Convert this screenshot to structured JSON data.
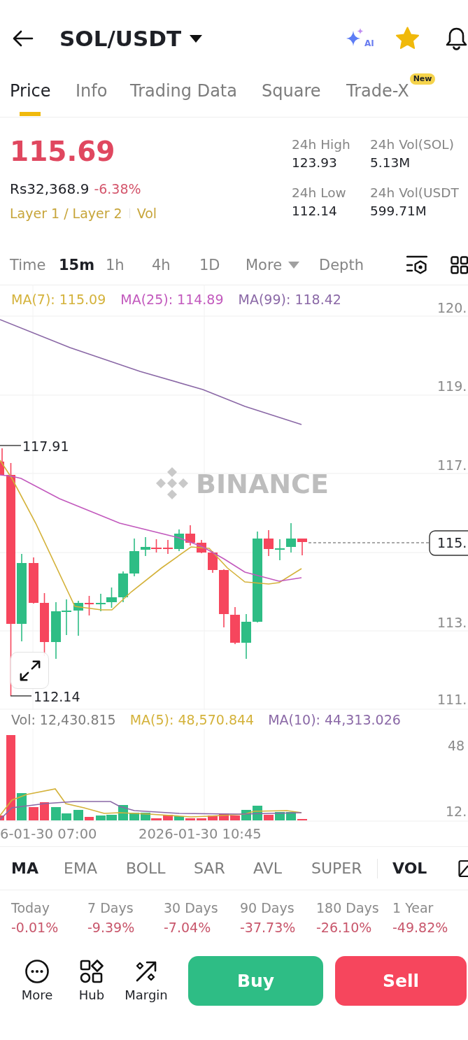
{
  "header": {
    "title": "SOL/USDT",
    "ai_label": "AI",
    "favorited": true
  },
  "tabs": [
    {
      "label": "Price",
      "selected": true
    },
    {
      "label": "Info",
      "selected": false
    },
    {
      "label": "Trading Data",
      "selected": false
    },
    {
      "label": "Square",
      "selected": false
    },
    {
      "label": "Trade-X",
      "selected": false,
      "badge": "New"
    }
  ],
  "ticker": {
    "last_price": "115.69",
    "local_price": "Rs32,368.9",
    "change": "-6.38%",
    "tags": [
      "Layer 1 / Layer 2",
      "Vol"
    ],
    "stats": [
      {
        "label": "24h High",
        "value": "123.93"
      },
      {
        "label": "24h Vol(SOL)",
        "value": "5.13M"
      },
      {
        "label": "24h Low",
        "value": "112.14"
      },
      {
        "label": "24h Vol(USDT",
        "value": "599.71M"
      }
    ]
  },
  "intervals": [
    {
      "label": "Time",
      "selected": false
    },
    {
      "label": "15m",
      "selected": true
    },
    {
      "label": "1h",
      "selected": false
    },
    {
      "label": "4h",
      "selected": false
    },
    {
      "label": "1D",
      "selected": false
    },
    {
      "label": "More",
      "selected": false,
      "dropdown": true
    },
    {
      "label": "Depth",
      "selected": false
    }
  ],
  "price_chart": {
    "legend": [
      {
        "label": "MA(7): 115.09",
        "color": "#d4b23a"
      },
      {
        "label": "MA(25): 114.89",
        "color": "#c259bd"
      },
      {
        "label": "MA(99): 118.42",
        "color": "#8a68a6"
      }
    ],
    "axis_labels": [
      "120.",
      "119.",
      "117.",
      "113.",
      "111."
    ],
    "last_price_tag": "115.",
    "high_label": "117.91",
    "low_label": "112.14",
    "watermark": "BINANCE"
  },
  "volume_chart": {
    "legend": [
      {
        "label": "Vol: 12,430.815",
        "color": "#7d7d7d"
      },
      {
        "label": "MA(5): 48,570.844",
        "color": "#d4b23a"
      },
      {
        "label": "MA(10): 44,313.026",
        "color": "#8a68a6"
      }
    ],
    "axis_labels": [
      "48",
      "12."
    ],
    "time_labels": [
      "6-01-30 07:00",
      "2026-01-30 10:45"
    ]
  },
  "indicators": {
    "main": [
      {
        "label": "MA",
        "selected": true
      },
      {
        "label": "EMA",
        "selected": false
      },
      {
        "label": "BOLL",
        "selected": false
      },
      {
        "label": "SAR",
        "selected": false
      },
      {
        "label": "AVL",
        "selected": false
      },
      {
        "label": "SUPER",
        "selected": false
      }
    ],
    "sub": [
      {
        "label": "VOL",
        "selected": true
      }
    ]
  },
  "performance": [
    {
      "period": "Today",
      "change": "-0.01%"
    },
    {
      "period": "7 Days",
      "change": "-9.39%"
    },
    {
      "period": "30 Days",
      "change": "-7.04%"
    },
    {
      "period": "90 Days",
      "change": "-37.73%"
    },
    {
      "period": "180 Days",
      "change": "-26.10%"
    },
    {
      "period": "1 Year",
      "change": "-49.82%"
    }
  ],
  "actions": [
    {
      "label": "More",
      "kind": "more"
    },
    {
      "label": "Hub",
      "kind": "hub"
    },
    {
      "label": "Margin",
      "kind": "margin"
    }
  ],
  "trade_buttons": [
    {
      "label": "Buy",
      "kind": "buy"
    },
    {
      "label": "Sell",
      "kind": "sell"
    }
  ]
}
